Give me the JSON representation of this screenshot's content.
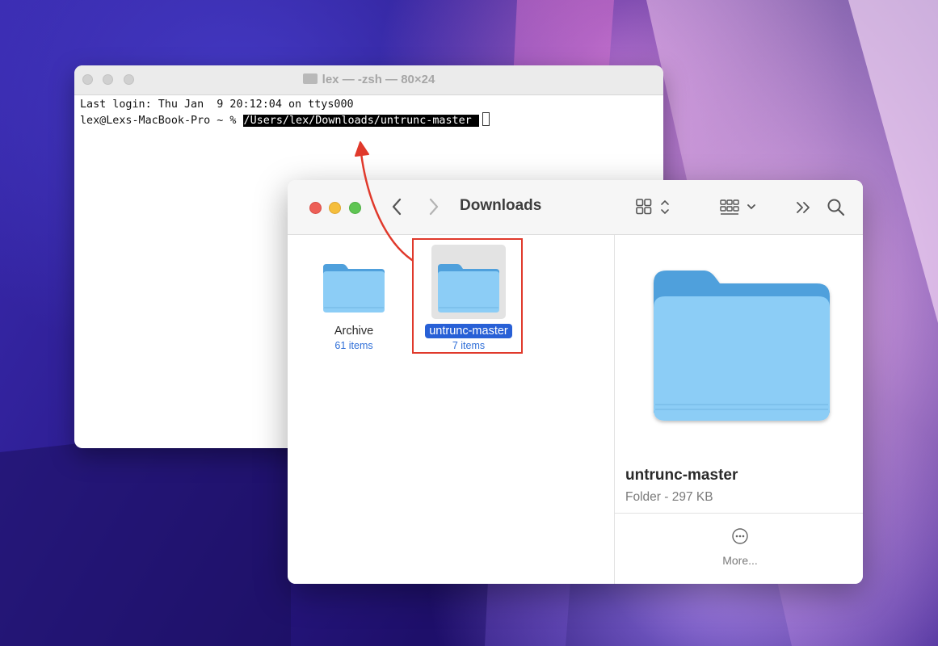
{
  "terminal": {
    "title": "lex — -zsh — 80×24",
    "line1": "Last login: Thu Jan  9 20:12:04 on ttys000",
    "prompt": "lex@Lexs-MacBook-Pro ~ % ",
    "command": "/Users/lex/Downloads/untrunc-master "
  },
  "finder": {
    "title": "Downloads",
    "items": [
      {
        "name": "Archive",
        "count": "61 items"
      },
      {
        "name": "untrunc-master",
        "count": "7 items"
      }
    ],
    "preview": {
      "name": "untrunc-master",
      "subtitle": "Folder - 297 KB",
      "more_label": "More..."
    }
  },
  "colors": {
    "accent": "#2860d6",
    "highlight": "#e0392b",
    "folder_light": "#8ccdf6",
    "folder_dark": "#4fa0dc"
  }
}
